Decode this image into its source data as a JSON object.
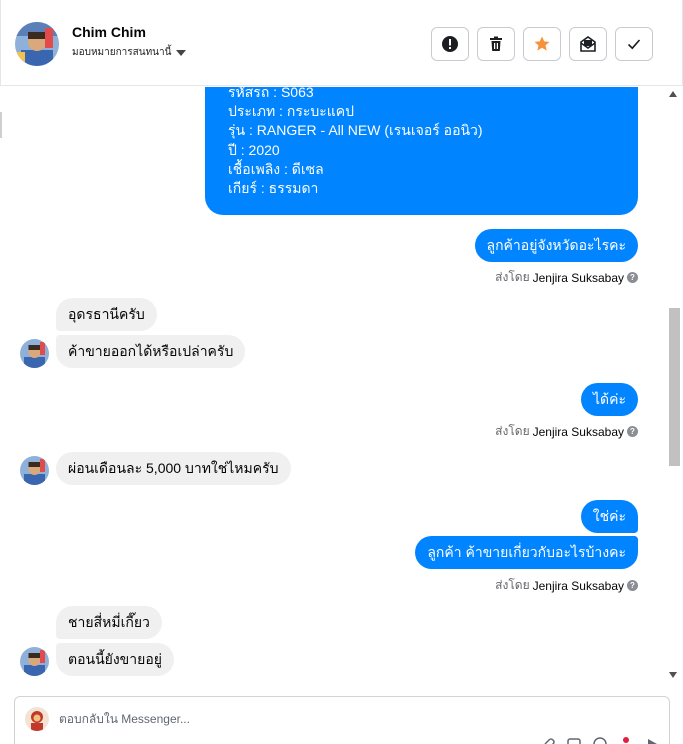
{
  "header": {
    "contact_name": "Chim Chim",
    "assign_label": "มอบหมายการสนทนานี้",
    "actions": [
      "alert-icon",
      "trash-icon",
      "star-icon",
      "mark-unread-icon",
      "check-icon"
    ]
  },
  "colors": {
    "outgoing_bubble": "#0084ff",
    "incoming_bubble": "#f0f0f0",
    "star_accent": "#f7923a"
  },
  "card": {
    "lines": [
      "รหัสรถ : S063",
      "ประเภท : กระบะแคป",
      "รุ่น : RANGER - All NEW (เรนเจอร์ ออนิว)",
      "ปี : 2020",
      "เชื้อเพลิง : ดีเซล",
      "เกียร์ : ธรรมดา"
    ]
  },
  "messages": {
    "m1": "ลูกค้าอยู่จังหวัดอะไรคะ",
    "m2": "อุดรธานีครับ",
    "m3": "ค้าขายออกได้หรือเปล่าครับ",
    "m4": "ได้ค่ะ",
    "m5": "ผ่อนเดือนละ 5,000 บาทใช่ไหมครับ",
    "m6": "ใช่ค่ะ",
    "m7": "ลูกค้า ค้าขายเกี่ยวกับอะไรบ้างคะ",
    "m8": "ชายสี่หมี่เกี๊ยว",
    "m9": "ตอนนี้ยังขายอยู่"
  },
  "sent_by": {
    "prefix": "ส่งโดย",
    "agent": "Jenjira Suksabay",
    "help": "?"
  },
  "composer": {
    "placeholder": "ตอบกลับใน Messenger..."
  }
}
